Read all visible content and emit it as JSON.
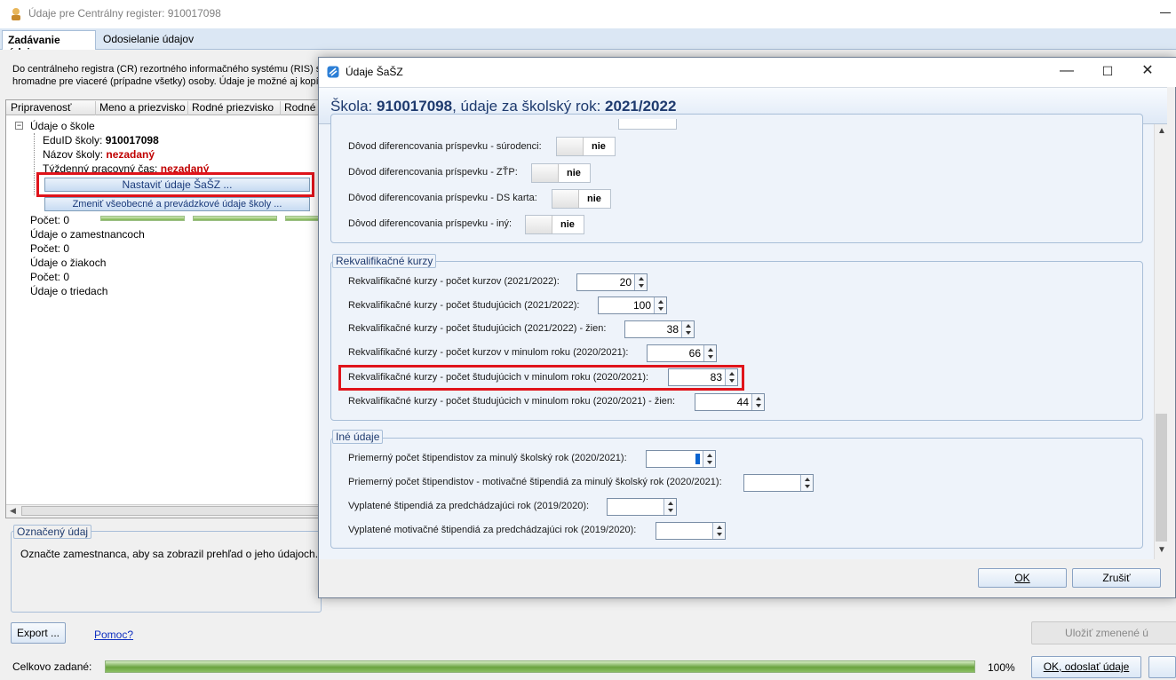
{
  "main": {
    "title": "Údaje pre Centrálny register: 910017098",
    "tabs": [
      {
        "label": "Zadávanie údajov"
      },
      {
        "label": "Odosielanie údajov"
      }
    ],
    "description_line1": "Do centrálneho registra (CR) rezortného informačného systému (RIS) s",
    "description_line2": "hromadne pre viaceré (prípadne všetky) osoby. Údaje je možné aj kopír",
    "grid_headers": [
      "Pripravenosť",
      "Meno a priezvisko",
      "Rodné priezvisko",
      "Rodné č"
    ],
    "tree": {
      "root": "Údaje o škole",
      "eduid_label": "EduID školy:",
      "eduid_value": "910017098",
      "name_label": "Názov školy:",
      "name_value": "nezadaný",
      "hours_label": "Týždenný pracovný čas:",
      "hours_value": "nezadaný",
      "btn_sasz": "Nastaviť údaje ŠaŠZ ...",
      "btn_general": "Zmeniť všeobecné a prevádzkové údaje školy ...",
      "count1": "Počet: 0",
      "employees": "Údaje o zamestnancoch",
      "count2": "Počet: 0",
      "pupils": "Údaje o žiakoch",
      "count3": "Počet: 0",
      "classes": "Údaje o triedach"
    },
    "marked_group_title": "Označený údaj",
    "marked_group_text": "Označte zamestnanca, aby sa zobrazil prehľad o jeho údajoch.",
    "export_btn": "Export ...",
    "help_link": "Pomoc?",
    "save_btn": "Uložiť zmenené ú",
    "total_label": "Celkovo zadané:",
    "total_percent": "100%",
    "total_progress": 1.0,
    "ok_send_btn": "OK, odoslať údaje"
  },
  "dialog": {
    "title": "Údaje ŠaŠZ",
    "header_prefix": "Škola: ",
    "header_school": "910017098",
    "header_mid": ", údaje za školský rok: ",
    "header_year": "2021/2022",
    "toggles": [
      {
        "label": "Dôvod diferencovania príspevku - súrodenci:",
        "value": "nie"
      },
      {
        "label": "Dôvod diferencovania príspevku - ZŤP:",
        "value": "nie"
      },
      {
        "label": "Dôvod diferencovania príspevku - DS karta:",
        "value": "nie"
      },
      {
        "label": "Dôvod diferencovania príspevku - iný:",
        "value": "nie"
      }
    ],
    "rekval_title": "Rekvalifikačné kurzy",
    "rekval": [
      {
        "label": "Rekvalifikačné kurzy - počet kurzov (2021/2022):",
        "value": "20"
      },
      {
        "label": "Rekvalifikačné kurzy - počet študujúcich (2021/2022):",
        "value": "100"
      },
      {
        "label": "Rekvalifikačné kurzy - počet študujúcich (2021/2022) - žien:",
        "value": "38"
      },
      {
        "label": "Rekvalifikačné kurzy - počet kurzov v minulom roku (2020/2021):",
        "value": "66"
      },
      {
        "label": "Rekvalifikačné kurzy - počet študujúcich v minulom roku (2020/2021):",
        "value": "83"
      },
      {
        "label": "Rekvalifikačné kurzy - počet študujúcich v minulom roku (2020/2021) - žien:",
        "value": "44"
      }
    ],
    "ine_title": "Iné údaje",
    "ine": [
      {
        "label": "Priemerný počet štipendistov za minulý školský rok (2020/2021):",
        "value": ""
      },
      {
        "label": "Priemerný počet štipendistov - motivačné štipendiá za minulý školský rok (2020/2021):",
        "value": ""
      },
      {
        "label": "Vyplatené štipendiá za predchádzajúci rok (2019/2020):",
        "value": ""
      },
      {
        "label": "Vyplatené motivačné štipendiá za predchádzajúci rok (2019/2020):",
        "value": ""
      }
    ],
    "ok_btn": "OK",
    "cancel_btn": "Zrušiť"
  },
  "colors": {
    "highlight": "#e0141b",
    "accent": "#1e3a6e",
    "progress": "#6aa33f"
  }
}
